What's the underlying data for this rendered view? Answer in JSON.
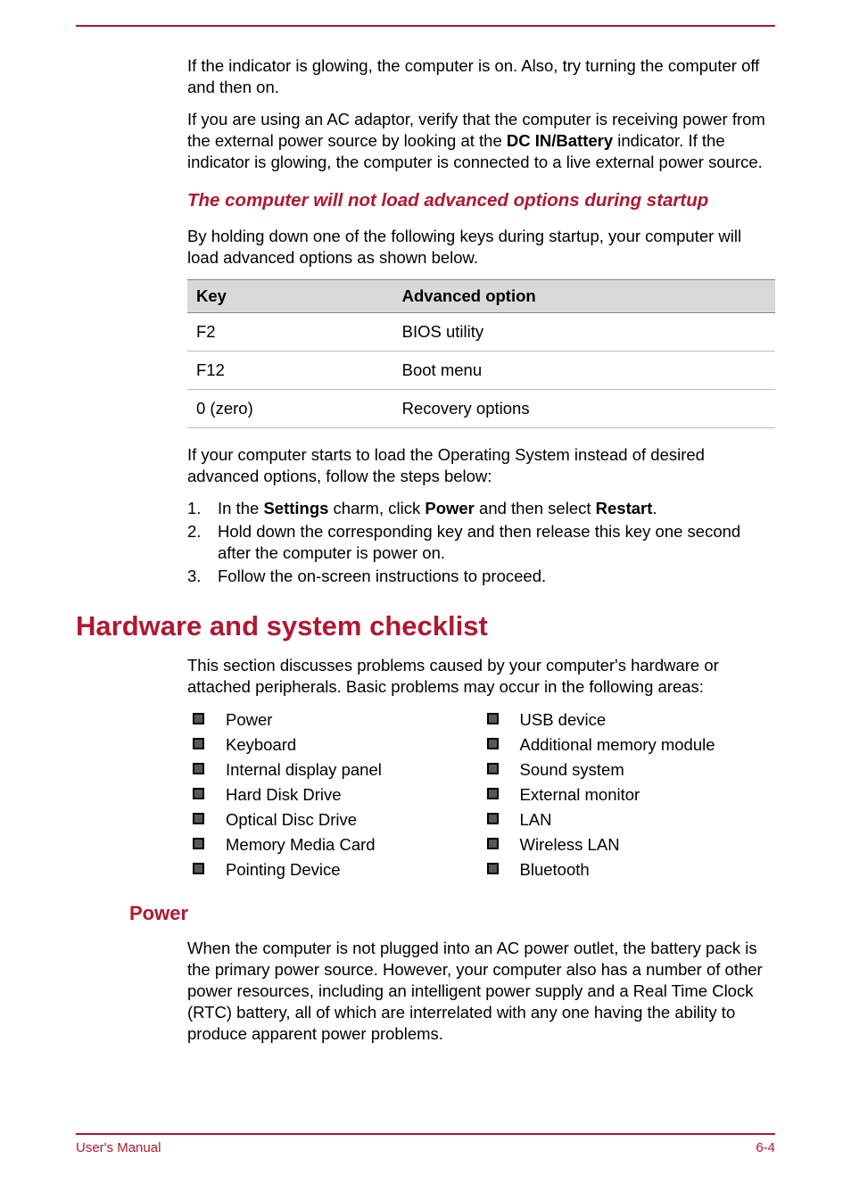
{
  "intro": {
    "p1": "If the indicator is glowing, the computer is on. Also, try turning the computer off and then on.",
    "p2a": "If you are using an AC adaptor, verify that the computer is receiving power from the external power source by looking at the ",
    "p2b": "DC IN/Battery",
    "p2c": " indicator. If the indicator is glowing, the computer is connected to a live external power source."
  },
  "sub1": {
    "heading": "The computer will not load advanced options during startup",
    "intro": "By holding down one of the following keys during startup, your computer will load advanced options as shown below.",
    "table": {
      "h1": "Key",
      "h2": "Advanced option",
      "rows": [
        {
          "key": "F2",
          "opt": "BIOS utility"
        },
        {
          "key": "F12",
          "opt": "Boot menu"
        },
        {
          "key": "0 (zero)",
          "opt": "Recovery options"
        }
      ]
    },
    "after_table": "If your computer starts to load the Operating System instead of desired advanced options, follow the steps below:",
    "steps": [
      {
        "n": "1.",
        "a": "In the ",
        "b1": "Settings",
        "c": " charm, click ",
        "b2": "Power",
        "d": " and then select ",
        "b3": "Restart",
        "e": "."
      },
      {
        "n": "2.",
        "text": "Hold down the corresponding key and then release this key one second after the computer is power on."
      },
      {
        "n": "3.",
        "text": "Follow the on-screen instructions to proceed."
      }
    ]
  },
  "hw": {
    "heading": "Hardware and system checklist",
    "intro": "This section discusses problems caused by your computer's hardware or attached peripherals. Basic problems may occur in the following areas:",
    "col1": [
      "Power",
      "Keyboard",
      "Internal display panel",
      "Hard Disk Drive",
      "Optical Disc Drive",
      "Memory Media Card",
      "Pointing Device"
    ],
    "col2": [
      "USB device",
      "Additional memory module",
      "Sound system",
      "External monitor",
      "LAN",
      "Wireless LAN",
      "Bluetooth"
    ]
  },
  "power": {
    "heading": "Power",
    "text": "When the computer is not plugged into an AC power outlet, the battery pack is the primary power source. However, your computer also has a number of other power resources, including an intelligent power supply and a Real Time Clock (RTC) battery, all of which are interrelated with any one having the ability to produce apparent power problems."
  },
  "footer": {
    "left": "User's Manual",
    "right": "6-4"
  }
}
